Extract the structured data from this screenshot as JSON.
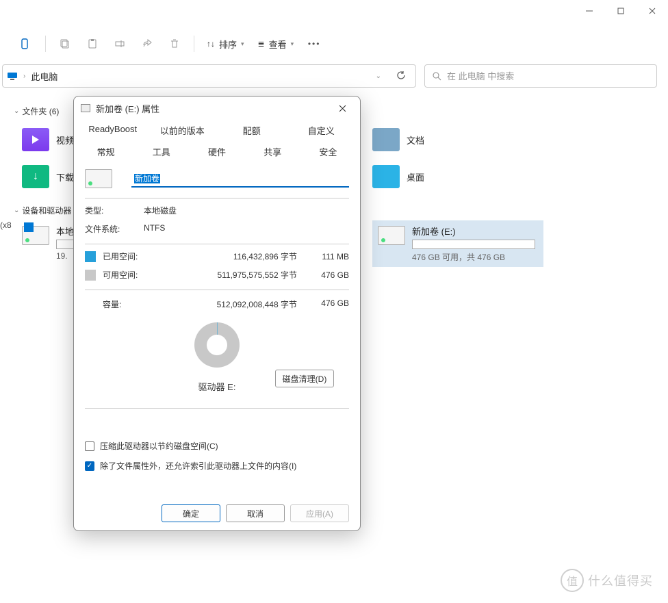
{
  "window_controls": {
    "min": "—",
    "max": "□",
    "close": "✕"
  },
  "toolbar": {
    "sort": "排序",
    "view": "查看"
  },
  "address": {
    "location": "此电脑",
    "refresh": "reload"
  },
  "search": {
    "placeholder": "在 此电脑 中搜索"
  },
  "sections": {
    "folders": "文件夹 (6)",
    "devices": "设备和驱动器"
  },
  "folders": {
    "video": "视频",
    "downloads": "下载",
    "documents": "文档",
    "desktop": "桌面"
  },
  "left_cut": "(x8",
  "drives": {
    "c": {
      "name": "本地",
      "sub": "19."
    },
    "e": {
      "name": "新加卷 (E:)",
      "sub": "476 GB 可用，共 476 GB"
    }
  },
  "dialog": {
    "title": "新加卷 (E:) 属性",
    "tabs_top": [
      "ReadyBoost",
      "以前的版本",
      "配额",
      "自定义"
    ],
    "tabs_bottom": [
      "常规",
      "工具",
      "硬件",
      "共享",
      "安全"
    ],
    "volume_name": "新加卷",
    "type_label": "类型:",
    "type_value": "本地磁盘",
    "fs_label": "文件系统:",
    "fs_value": "NTFS",
    "used_label": "已用空间:",
    "used_bytes": "116,432,896 字节",
    "used_hr": "111 MB",
    "free_label": "可用空间:",
    "free_bytes": "511,975,575,552 字节",
    "free_hr": "476 GB",
    "cap_label": "容量:",
    "cap_bytes": "512,092,008,448 字节",
    "cap_hr": "476 GB",
    "drive_label": "驱动器 E:",
    "cleanup": "磁盘清理(D)",
    "compress": "压缩此驱动器以节约磁盘空间(C)",
    "index": "除了文件属性外，还允许索引此驱动器上文件的内容(I)",
    "ok": "确定",
    "cancel": "取消",
    "apply": "应用(A)"
  },
  "watermark": {
    "badge": "值",
    "text": "什么值得买"
  },
  "colors": {
    "used": "#26a0da",
    "free": "#c8c8c8",
    "accent": "#0067c0"
  }
}
